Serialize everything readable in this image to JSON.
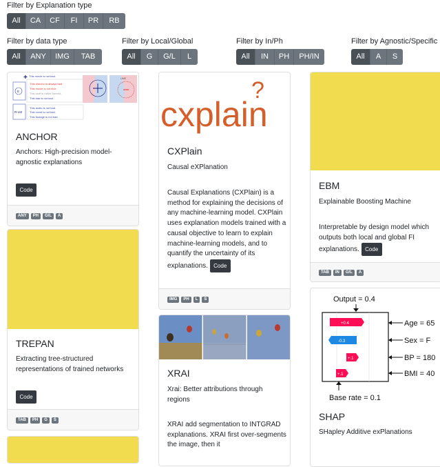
{
  "filters": {
    "explanation": {
      "label": "Filter by Explanation type",
      "options": [
        "All",
        "CA",
        "CF",
        "FI",
        "PR",
        "RB"
      ]
    },
    "data": {
      "label": "Filter by data type",
      "options": [
        "All",
        "ANY",
        "IMG",
        "TAB"
      ]
    },
    "local": {
      "label": "Filter by Local/Global",
      "options": [
        "All",
        "G",
        "G/L",
        "L"
      ]
    },
    "inph": {
      "label": "Filter by In/Ph",
      "options": [
        "All",
        "IN",
        "PH",
        "PH/IN"
      ]
    },
    "agnostic": {
      "label": "Filter by Agnostic/Specific",
      "options": [
        "All",
        "A",
        "S"
      ]
    }
  },
  "code_label": "Code",
  "cards": {
    "anchor": {
      "title": "ANCHOR",
      "subtitle": "Anchors: High-precision model-agnostic explanations",
      "badges": [
        "ANY",
        "PH",
        "G/L",
        "A"
      ],
      "img": {
        "plus": "+",
        "r1": "This movie is not bad.",
        "r2": "This director is always bad.",
        "r3": "This movie is not nice.",
        "r4": "This stuff is rather honest.",
        "r5": "This star is not bad.",
        "e": "E",
        "r6": "This audio is not bad.",
        "r7": "This novel is not bad.",
        "r8": "This footage is not bad.",
        "rlm": "R-LM",
        "lime": "LIME"
      }
    },
    "trepan": {
      "title": "TREPAN",
      "subtitle": "Extracting tree-structured representations of trained networks",
      "badges": [
        "TAB",
        "PH",
        "G",
        "S"
      ]
    },
    "cxplain": {
      "title": "CXPlain",
      "subtitle": "Causal eXPlanation",
      "logo": "cxplain",
      "logo_q": "?",
      "desc": "Causal Explanations (CXPlain) is a method for explaining the decisions of any machine-learning model. CXPlain uses explanation models trained with a causal objective to learn to explain machine-learning models, and to quantify the uncertainty of its explanations.",
      "badges": [
        "IMG",
        "PH",
        "L",
        "S"
      ]
    },
    "xrai": {
      "title": "XRAI",
      "subtitle": "Xrai: Better attributions through regions",
      "desc": "XRAI add segmentation to INTGRAD explanations. XRAI first over-segments the image, then it"
    },
    "ebm": {
      "title": "EBM",
      "subtitle": "Explainable Boosting Machine",
      "desc": "Interpretable by design model which outputs both local and global FI explanations.",
      "badges": [
        "TAB",
        "IN",
        "G/L",
        "A"
      ]
    },
    "shap": {
      "title": "SHAP",
      "subtitle": "SHapley Additive exPlanations",
      "figure": {
        "output": "Output = 0.4",
        "base": "Base rate = 0.1",
        "rows": [
          {
            "value": "+0.4",
            "label": "Age = 65"
          },
          {
            "value": "-0.3",
            "label": "Sex = F"
          },
          {
            "value": "+.1",
            "label": "BP = 180"
          },
          {
            "value": "+.1",
            "label": "BMI = 40"
          }
        ]
      }
    }
  },
  "colors": {
    "btn": "#6c757d",
    "btn_active": "#4a5157",
    "code": "#343a40",
    "yellow": "#f0dc4e",
    "cxplain_orange": "#d45f2b",
    "shap_pos": "#ff0d57",
    "shap_neg": "#1e88e5"
  }
}
